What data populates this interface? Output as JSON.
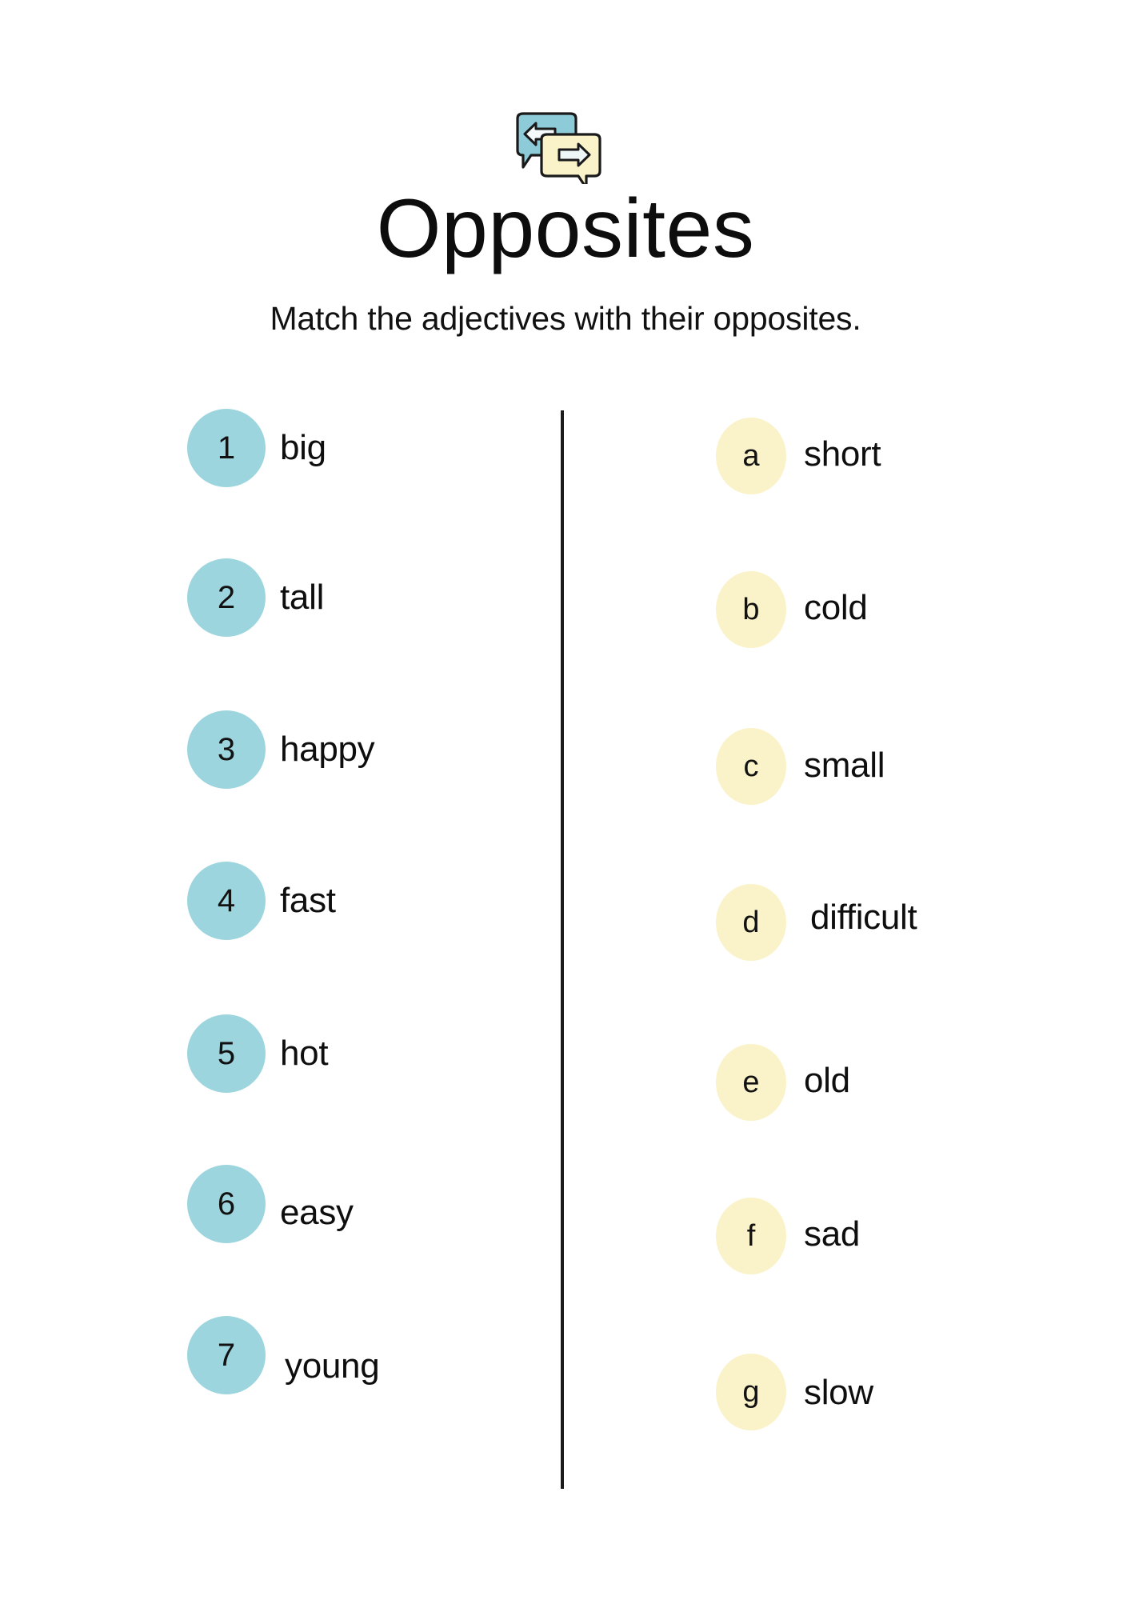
{
  "header": {
    "icon_name": "two-speech-bubbles-swap-icon",
    "title": "Opposites",
    "subtitle": "Match the adjectives with their opposites."
  },
  "colors": {
    "left_bubble": "#9DD5DE",
    "right_bubble": "#FAF3CA",
    "text": "#111111",
    "divider": "#1B1B1B",
    "background": "#FFFFFF",
    "icon_teal": "#8ECBD8",
    "icon_cream": "#FAF3CA",
    "icon_outline": "#1A1A1A"
  },
  "left_column": {
    "name": "adjectives",
    "items": [
      {
        "marker": "1",
        "word": "big"
      },
      {
        "marker": "2",
        "word": "tall"
      },
      {
        "marker": "3",
        "word": "happy"
      },
      {
        "marker": "4",
        "word": "fast"
      },
      {
        "marker": "5",
        "word": "hot"
      },
      {
        "marker": "6",
        "word": "easy"
      },
      {
        "marker": "7",
        "word": "young"
      }
    ]
  },
  "right_column": {
    "name": "opposites",
    "items": [
      {
        "marker": "a",
        "word": "short"
      },
      {
        "marker": "b",
        "word": "cold"
      },
      {
        "marker": "c",
        "word": "small"
      },
      {
        "marker": "d",
        "word": "difficult"
      },
      {
        "marker": "e",
        "word": "old"
      },
      {
        "marker": "f",
        "word": "sad"
      },
      {
        "marker": "g",
        "word": "slow"
      }
    ]
  }
}
